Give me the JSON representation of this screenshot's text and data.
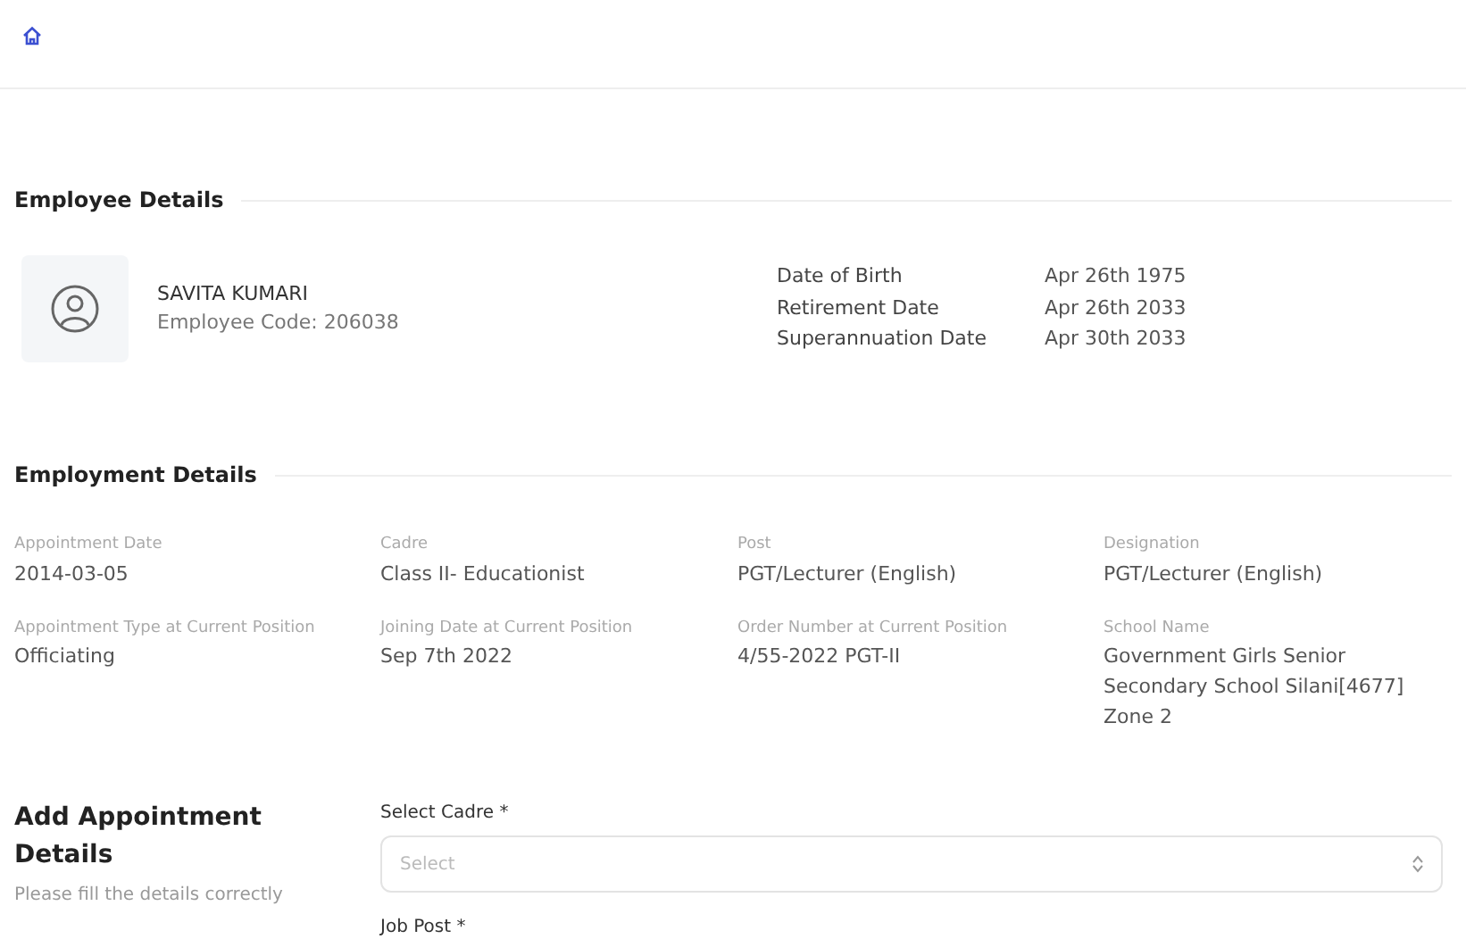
{
  "employee_details": {
    "title": "Employee Details",
    "name": "SAVITA KUMARI",
    "code": "Employee Code: 206038",
    "dates": [
      {
        "label": "Date of Birth",
        "value": "Apr 26th 1975"
      },
      {
        "label": "Retirement Date",
        "value": "Apr 26th 2033"
      },
      {
        "label": "Superannuation Date",
        "value": "Apr 30th 2033"
      }
    ]
  },
  "employment_details": {
    "title": "Employment Details",
    "fields": [
      {
        "label": "Appointment Date",
        "value": "2014-03-05"
      },
      {
        "label": "Cadre",
        "value": "Class II- Educationist"
      },
      {
        "label": "Post",
        "value": "PGT/Lecturer (English)"
      },
      {
        "label": "Designation",
        "value": "PGT/Lecturer (English)"
      },
      {
        "label": "Appointment Type at Current Position",
        "value": "Officiating"
      },
      {
        "label": "Joining Date at Current Position",
        "value": "Sep 7th 2022"
      },
      {
        "label": "Order Number at Current Position",
        "value": "4/55-2022 PGT-II"
      },
      {
        "label": "School Name",
        "value": "Government Girls Senior Secondary School Silani[4677] Zone 2"
      }
    ]
  },
  "add_appointment": {
    "title": "Add Appointment Details",
    "description": "Please fill the details correctly",
    "fields": [
      {
        "label": "Select Cadre *",
        "placeholder": "Select"
      },
      {
        "label": "Job Post *"
      }
    ]
  }
}
